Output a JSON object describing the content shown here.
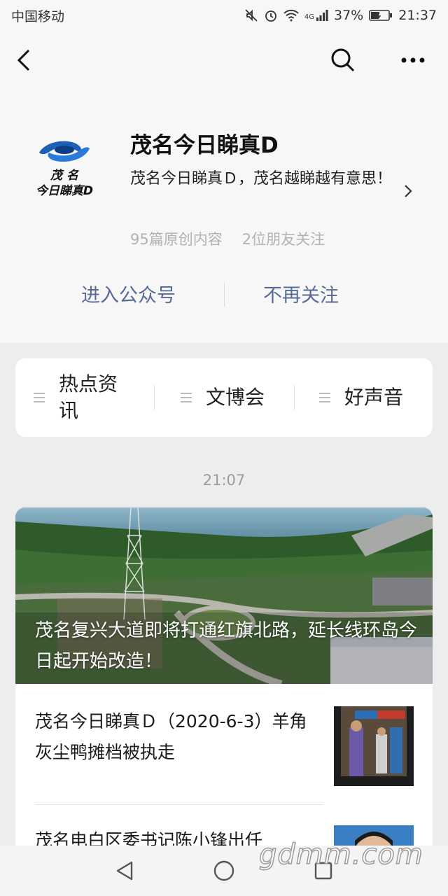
{
  "status_bar": {
    "carrier": "中国移动",
    "network": "4G",
    "battery": "37%",
    "time": "21:37",
    "icons": [
      "mute-icon",
      "alarm-icon",
      "wifi-icon",
      "signal-icon",
      "battery-icon"
    ]
  },
  "nav": {
    "back_icon": "chevron-left-icon",
    "search_icon": "search-icon",
    "more_icon": "more-dots-icon"
  },
  "account": {
    "logo_text_top": "茂 名",
    "logo_text_bottom": "今日睇真D",
    "name": "茂名今日睇真D",
    "description": "茂名今日睇真Ｄ，茂名越睇越有意思！",
    "original_count": "95篇原创内容",
    "friends_following": "2位朋友关注",
    "enter_label": "进入公众号",
    "unfollow_label": "不再关注"
  },
  "menu": {
    "items": [
      {
        "label": "热点资讯"
      },
      {
        "label": "文博会"
      },
      {
        "label": "好声音"
      }
    ]
  },
  "feed": {
    "time": "21:07",
    "cover_title": "茂名复兴大道即将打通红旗北路，延长线环岛今日起开始改造！",
    "articles": [
      {
        "title": "茂名今日睇真Ｄ（2020-6-3）羊角灰尘鸭摊档被执走"
      },
      {
        "title": "茂名电白区委书记陈小锋出任"
      }
    ]
  },
  "system_nav": {
    "back_icon": "triangle-back-icon",
    "home_icon": "circle-home-icon",
    "recents_icon": "square-recents-icon"
  },
  "watermark": "gdmm.com",
  "colors": {
    "link_blue": "#576b95",
    "background": "#ededed",
    "header_bg": "#f7f7f7",
    "logo_blue": "#1f5fb5"
  }
}
